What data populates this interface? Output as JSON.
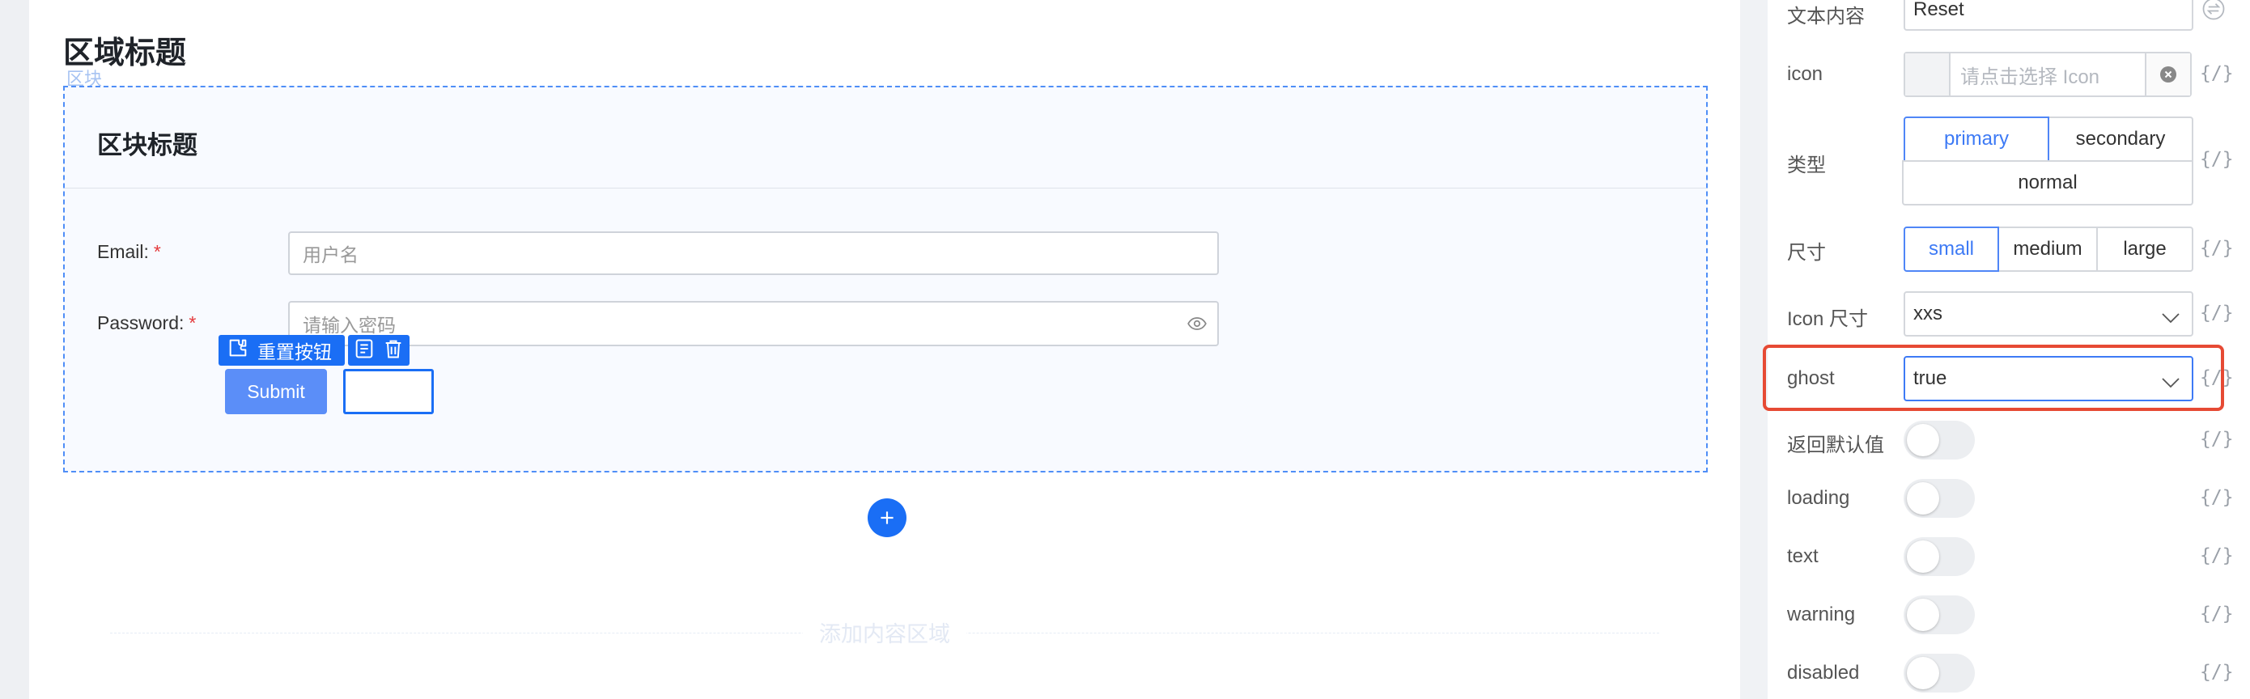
{
  "canvas": {
    "section_title": "区域标题",
    "block_tag": "区块",
    "block_title": "区块标题",
    "form": {
      "email_label": "Email:",
      "email_placeholder": "用户名",
      "password_label": "Password:",
      "password_placeholder": "请输入密码",
      "required_mark": "*"
    },
    "selection": {
      "component_label": "重置按钮"
    },
    "submit_label": "Submit",
    "add_area_text": "添加内容区域"
  },
  "props": {
    "text_content_label": "文本内容",
    "text_content_value": "Reset",
    "icon_label": "icon",
    "icon_placeholder": "请点击选择 Icon",
    "type_label": "类型",
    "type_options": [
      "primary",
      "secondary",
      "normal"
    ],
    "type_selected": "primary",
    "size_label": "尺寸",
    "size_options": [
      "small",
      "medium",
      "large"
    ],
    "size_selected": "small",
    "icon_size_label": "Icon 尺寸",
    "icon_size_value": "xxs",
    "ghost_label": "ghost",
    "ghost_value": "true",
    "toggles": [
      {
        "label": "返回默认值",
        "on": false
      },
      {
        "label": "loading",
        "on": false
      },
      {
        "label": "text",
        "on": false
      },
      {
        "label": "warning",
        "on": false
      },
      {
        "label": "disabled",
        "on": false
      }
    ],
    "expr_icon_text": "{/}"
  },
  "colors": {
    "accent": "#1a6ef5",
    "highlight": "#e64a34",
    "submit": "#5b8ef8"
  }
}
